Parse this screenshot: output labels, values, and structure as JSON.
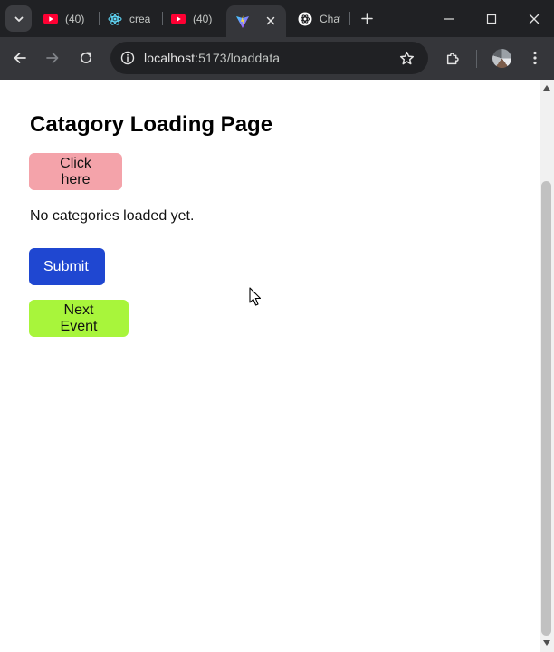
{
  "browser": {
    "tabs": [
      {
        "title": "(40)",
        "icon": "youtube-icon",
        "active": false
      },
      {
        "title": "crea",
        "icon": "react-icon",
        "active": false
      },
      {
        "title": "(40)",
        "icon": "youtube-icon",
        "active": false
      },
      {
        "title": "",
        "icon": "vite-icon",
        "active": true
      },
      {
        "title": "Chat",
        "icon": "chatgpt-icon",
        "active": false
      }
    ],
    "url_host": "localhost",
    "url_path": ":5173/loaddata",
    "colors": {
      "frame": "#202124",
      "toolbar": "#35363a",
      "omnibox": "#202124"
    }
  },
  "page": {
    "heading": "Catagory Loading Page",
    "click_button_label": "Click here",
    "status_text": "No categories loaded yet.",
    "submit_button_label": "Submit",
    "next_event_button_label": "Next Event",
    "colors": {
      "click": "#f4a3aa",
      "submit": "#1f47d1",
      "next": "#a8f53b"
    }
  }
}
